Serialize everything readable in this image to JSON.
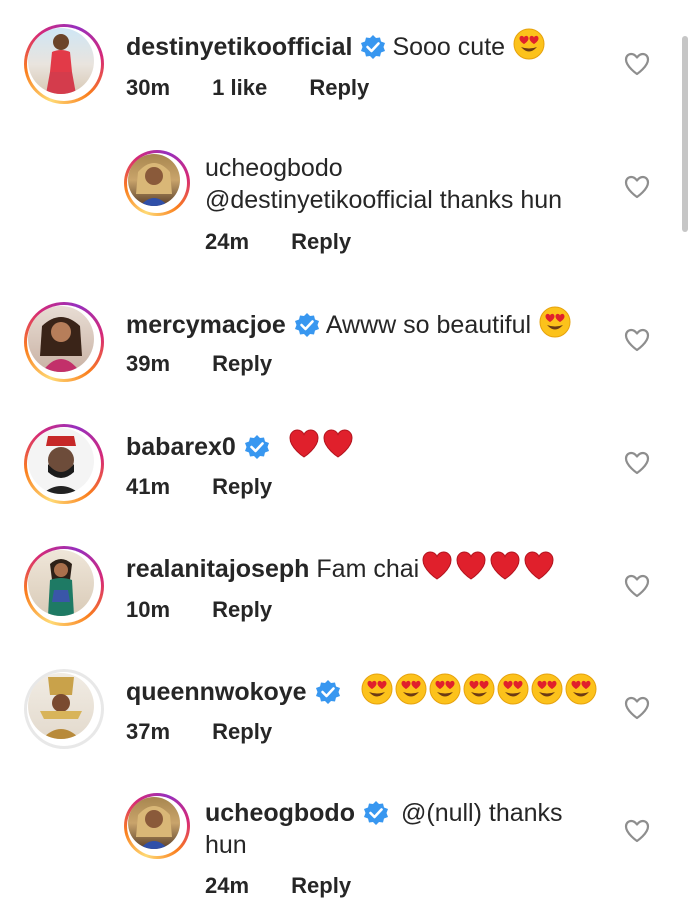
{
  "comments": [
    {
      "username": "destinyetikoofficial",
      "verified": true,
      "text": "Sooo cute",
      "time": "30m",
      "likes": "1 like",
      "reply": "Reply",
      "avatar_icon": "avatar-photo-woman-red-swimsuit"
    },
    {
      "username": "ucheogbodo",
      "verified": false,
      "text": "@destinyetikoofficial thanks hun",
      "time": "24m",
      "reply": "Reply",
      "avatar_icon": "avatar-photo-woman-blonde"
    },
    {
      "username": "mercymacjoe",
      "verified": true,
      "text": "Awww so beautiful",
      "time": "39m",
      "reply": "Reply",
      "avatar_icon": "avatar-photo-woman-dark-hair"
    },
    {
      "username": "babarex0",
      "verified": true,
      "text": "",
      "time": "41m",
      "reply": "Reply",
      "avatar_icon": "avatar-illustration-man-cap"
    },
    {
      "username": "realanitajoseph",
      "verified": false,
      "text": "Fam chai",
      "time": "10m",
      "reply": "Reply",
      "avatar_icon": "avatar-photo-woman-green-dress"
    },
    {
      "username": "queennwokoye",
      "verified": true,
      "text": "",
      "time": "37m",
      "reply": "Reply",
      "avatar_icon": "avatar-photo-woman-headdress"
    },
    {
      "username": "ucheogbodo",
      "verified": true,
      "text": "@(null) thanks",
      "text_line2": "hun",
      "time": "24m",
      "reply": "Reply",
      "avatar_icon": "avatar-photo-woman-blonde"
    }
  ],
  "colors": {
    "verified": "#3897f0",
    "heart_emoji": "#e0202c",
    "like_outline": "#8e8e8e"
  }
}
